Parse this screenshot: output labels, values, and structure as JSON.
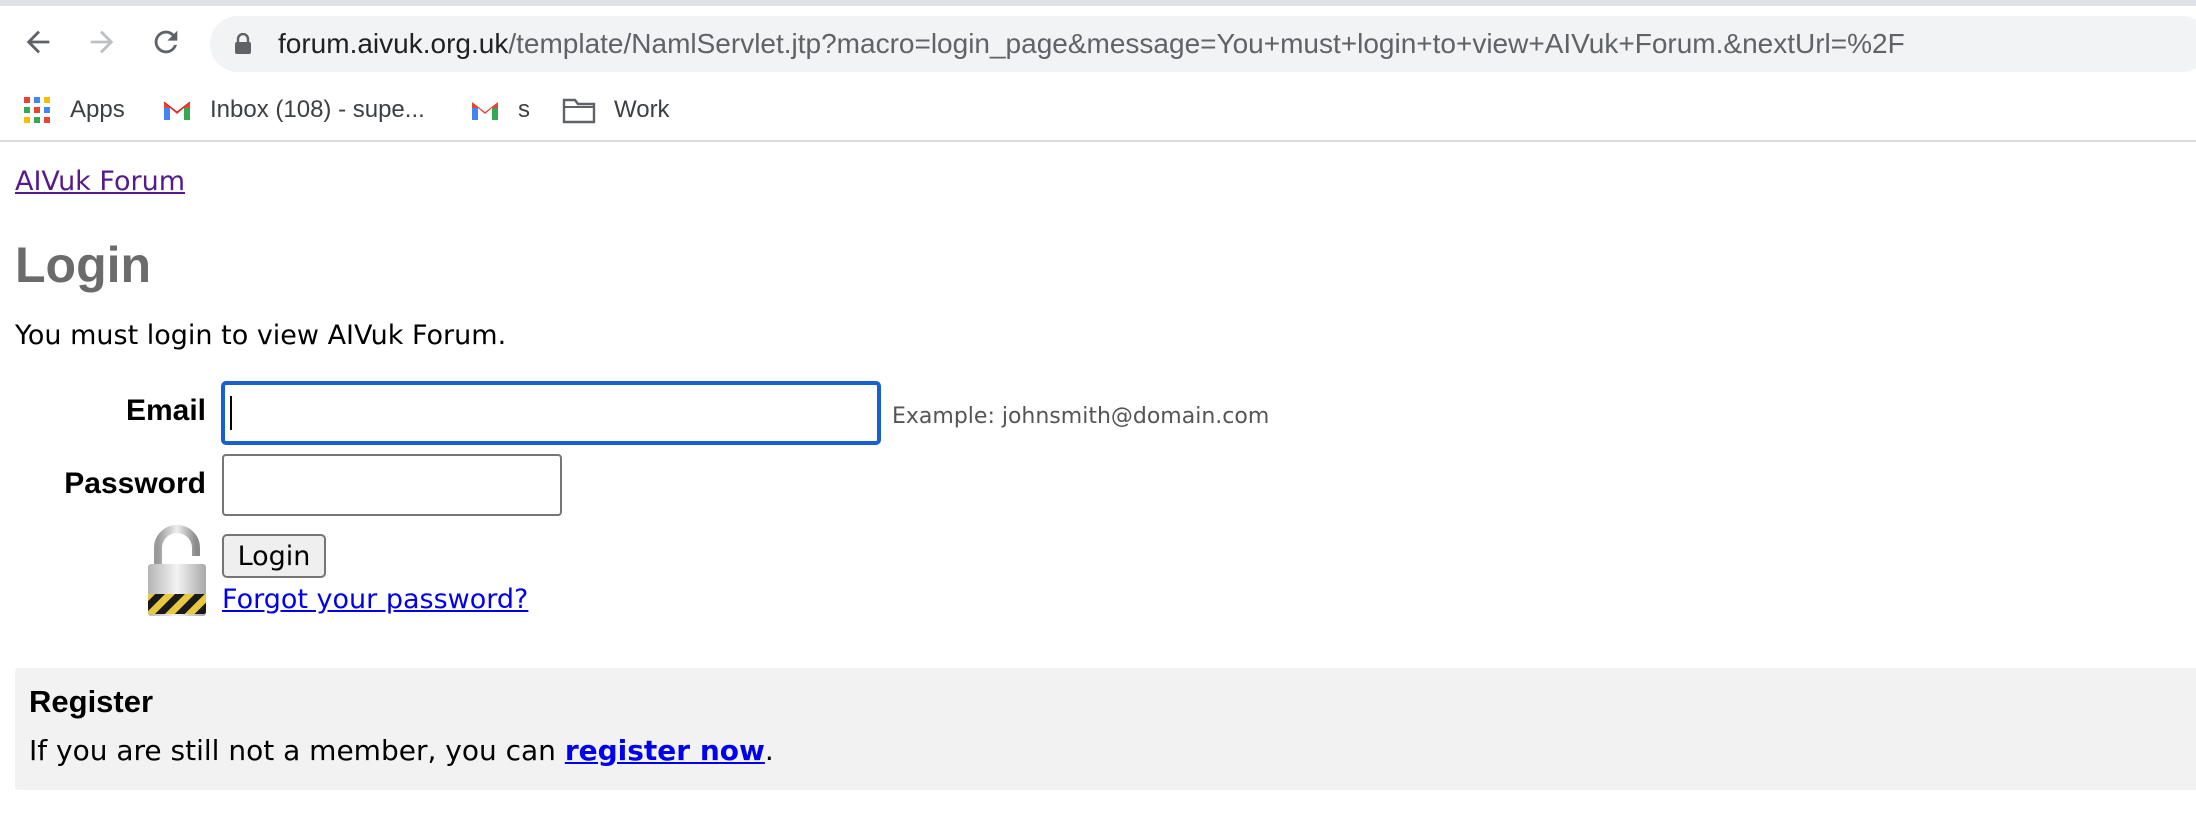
{
  "browser": {
    "url_host": "forum.aivuk.org.uk",
    "url_rest": "/template/NamlServlet.jtp?macro=login_page&message=You+must+login+to+view+AIVuk+Forum.&nextUrl=%2F",
    "bookmarks": [
      {
        "label": "Apps",
        "icon": "apps-grid-icon"
      },
      {
        "label": "Inbox (108) - supe...",
        "icon": "gmail-icon"
      },
      {
        "label": "s",
        "icon": "gmail-icon"
      },
      {
        "label": "Work",
        "icon": "folder-icon"
      }
    ]
  },
  "page": {
    "forum_link": "AIVuk Forum",
    "title": "Login",
    "message": "You must login to view AIVuk Forum.",
    "form": {
      "email_label": "Email",
      "email_value": "",
      "email_hint": "Example: johnsmith@domain.com",
      "password_label": "Password",
      "password_value": "",
      "login_button": "Login",
      "forgot_link": "Forgot your password?"
    },
    "register": {
      "title": "Register",
      "text_before": "If you are still not a member, you can ",
      "link": "register now",
      "text_after": "."
    }
  },
  "colors": {
    "visited_link": "#551a8b",
    "link": "#0000ee",
    "focus_ring": "#1a5fd1",
    "title_gray": "#6b6b6b",
    "register_bg": "#f2f2f2"
  }
}
